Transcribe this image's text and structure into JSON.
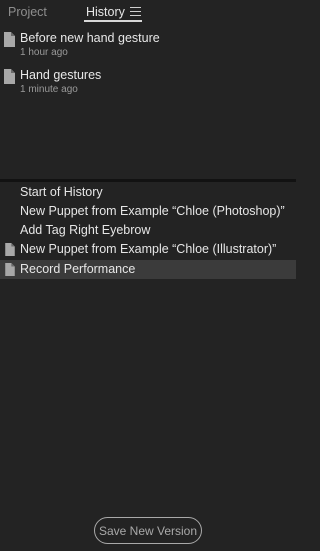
{
  "tabs": {
    "project": "Project",
    "history": "History",
    "menu_icon": "hamburger-menu-icon"
  },
  "versions": [
    {
      "title": "Before new hand gesture",
      "time": "1 hour ago",
      "icon": "document-icon"
    },
    {
      "title": "Hand gestures",
      "time": "1 minute ago",
      "icon": "document-icon"
    }
  ],
  "history": [
    {
      "label": "Start of History",
      "icon": null,
      "selected": false
    },
    {
      "label": "New Puppet from Example “Chloe (Photoshop)”",
      "icon": null,
      "selected": false
    },
    {
      "label": "Add Tag Right Eyebrow",
      "icon": null,
      "selected": false
    },
    {
      "label": "New Puppet from Example “Chloe (Illustrator)”",
      "icon": "document-icon",
      "selected": false
    },
    {
      "label": "Record Performance",
      "icon": "document-icon",
      "selected": true
    }
  ],
  "footer": {
    "save_label": "Save New Version"
  },
  "colors": {
    "background": "#232323",
    "selected_row": "#3b3b3b",
    "divider": "#121212",
    "text": "#e6e6e6",
    "muted_text": "#9a9a9a",
    "button_outline": "#a9a9a9"
  }
}
